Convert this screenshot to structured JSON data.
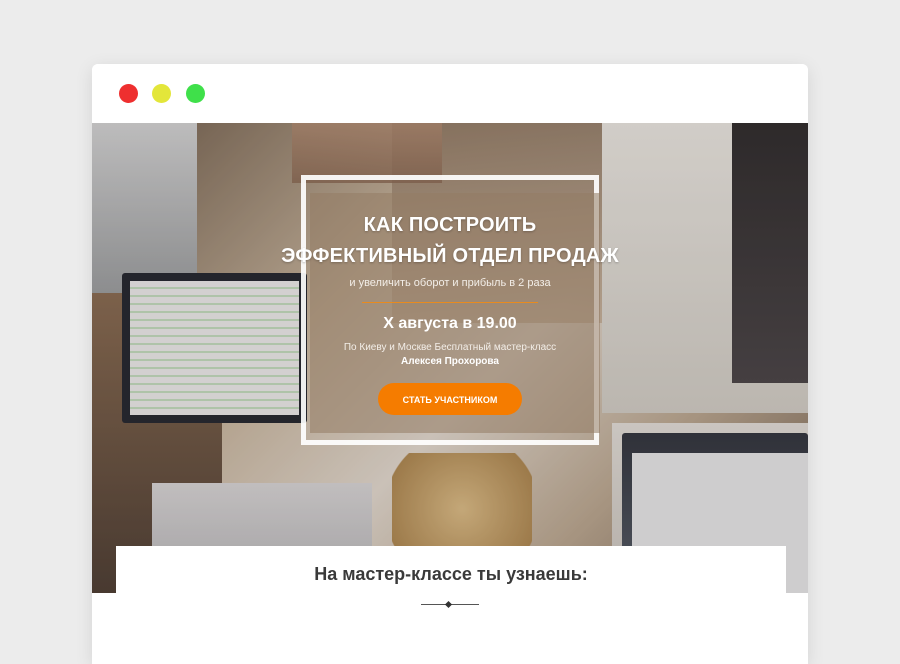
{
  "window": {
    "controls": [
      "close",
      "minimize",
      "maximize"
    ]
  },
  "hero": {
    "title_line1": "КАК ПОСТРОИТЬ",
    "title_line2": "ЭФФЕКТИВНЫЙ ОТДЕЛ ПРОДАЖ",
    "subtitle": "и увеличить оборот и прибыль в 2 раза",
    "date": "Х августа в 19.00",
    "description": "По Киеву и Москве Бесплатный мастер-класс",
    "author": "Алексея Прохорова",
    "cta_label": "СТАТЬ УЧАСТНИКОМ"
  },
  "section": {
    "title": "На мастер-классе ты узнаешь:"
  },
  "colors": {
    "accent": "#f57c00",
    "divider": "#e88b1f",
    "close": "#ee2f2f",
    "minimize": "#e3e63a",
    "maximize": "#3fe04a"
  }
}
